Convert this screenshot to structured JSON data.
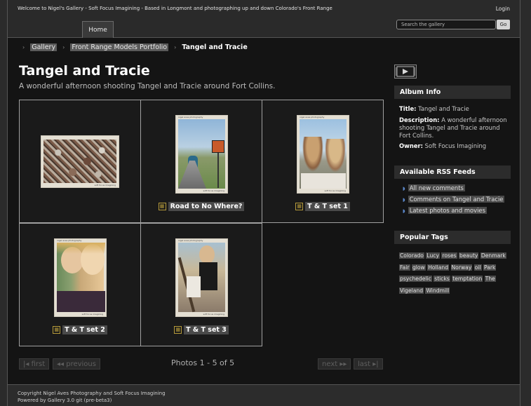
{
  "header": {
    "welcome": "Welcome to Nigel's Gallery - Soft Focus Imagining - Based in Longmont and photographing up and down Colorado's Front Range",
    "login": "Login",
    "home_tab": "Home",
    "search_placeholder": "Search the gallery",
    "search_button": "Go"
  },
  "breadcrumb": {
    "items": [
      "Gallery",
      "Front Range Models Portfolio"
    ],
    "current": "Tangel and Tracie"
  },
  "album": {
    "title": "Tangel and Tracie",
    "description": "A wonderful afternoon shooting Tangel and Tracie around Fort Collins."
  },
  "grid": {
    "items": [
      {
        "type": "photo",
        "title": ""
      },
      {
        "type": "album",
        "title": "Road to No Where?"
      },
      {
        "type": "album",
        "title": "T & T set 1"
      },
      {
        "type": "album",
        "title": "T & T set 2"
      },
      {
        "type": "album",
        "title": "T & T set 3"
      }
    ]
  },
  "pager": {
    "first": "first",
    "previous": "previous",
    "info": "Photos 1 - 5 of 5",
    "next": "next",
    "last": "last"
  },
  "sidebar": {
    "album_info": {
      "heading": "Album Info",
      "title_label": "Title:",
      "title_value": "Tangel and Tracie",
      "description_label": "Description:",
      "description_value": "A wonderful afternoon shooting Tangel and Tracie around Fort Collins.",
      "owner_label": "Owner:",
      "owner_value": "Soft Focus Imagining"
    },
    "rss": {
      "heading": "Available RSS Feeds",
      "items": [
        "All new comments",
        "Comments on Tangel and Tracie",
        "Latest photos and movies"
      ]
    },
    "tags": {
      "heading": "Popular Tags",
      "items": [
        "Colorado",
        "Lucy",
        "roses",
        "beauty",
        "Denmark",
        "Fair",
        "glow",
        "Holland",
        "Norway",
        "oil",
        "Park",
        "psychedelic",
        "sticks",
        "temptation",
        "The",
        "Vigeland",
        "Windmill"
      ]
    }
  },
  "footer": {
    "copyright": "Copyright Nigel Aves Photography and Soft Focus Imagining",
    "powered": "Powered by Gallery 3.0 git (pre-beta3)"
  },
  "thumb_caption_top": "nigel aves photography",
  "thumb_caption_bottom": "soft focus imagining"
}
